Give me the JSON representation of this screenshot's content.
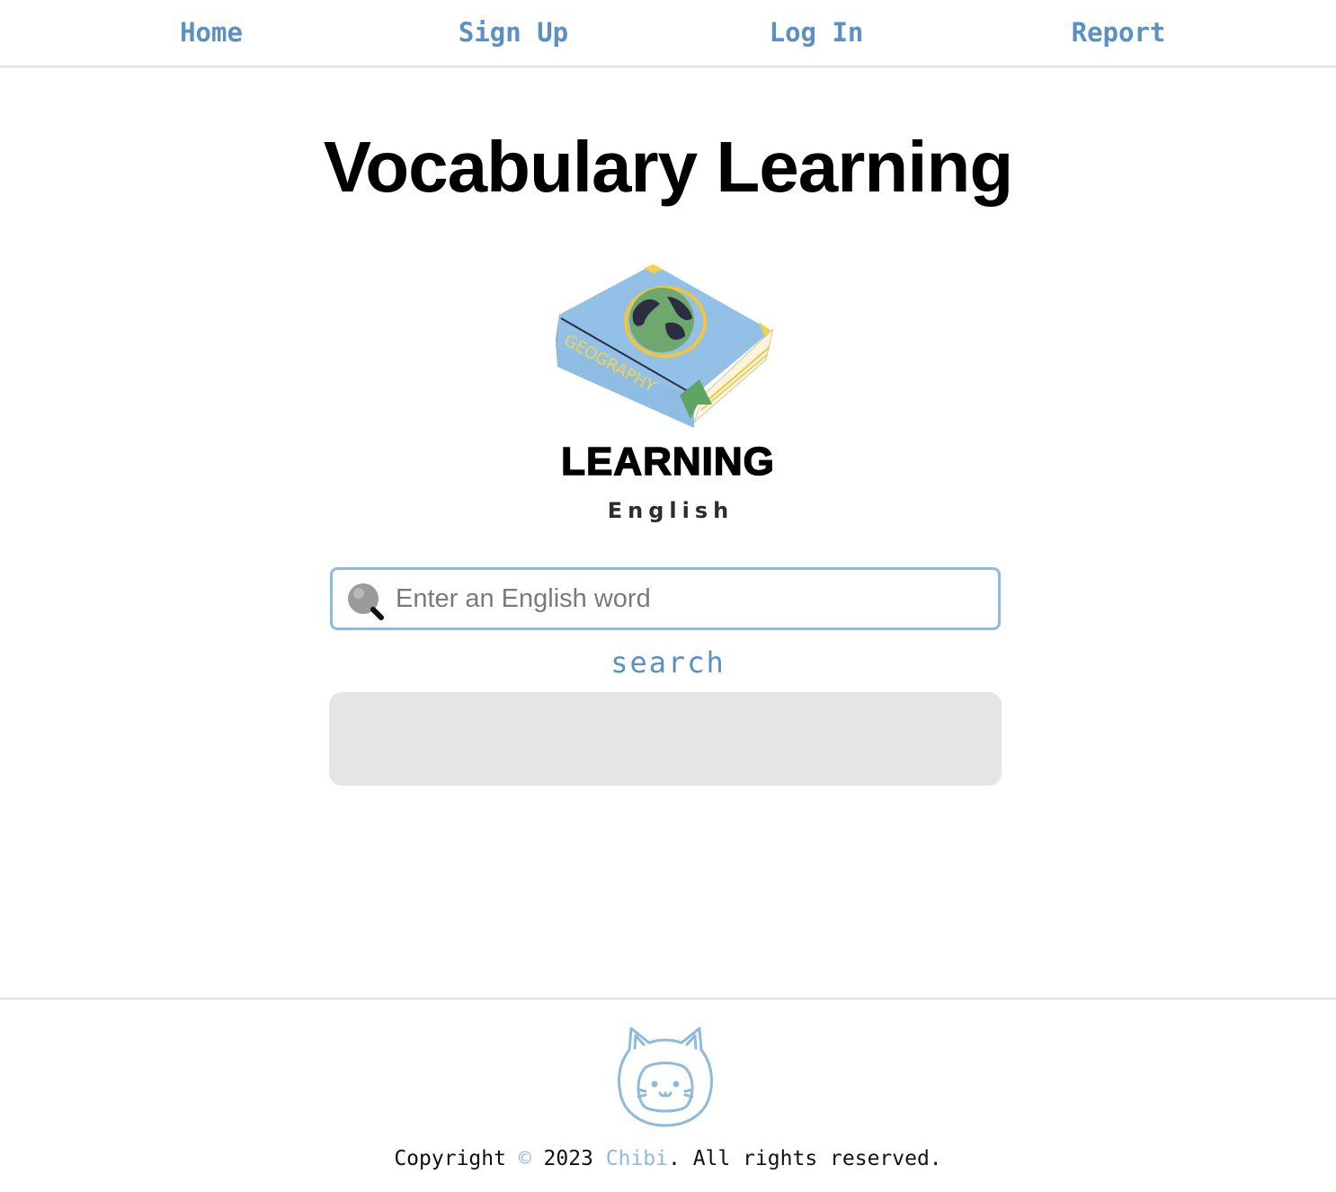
{
  "nav": {
    "items": [
      {
        "label": "Home"
      },
      {
        "label": "Sign Up"
      },
      {
        "label": "Log In"
      },
      {
        "label": "Report"
      }
    ]
  },
  "page": {
    "title": "Vocabulary Learning"
  },
  "logo": {
    "book_spine_text": "GEOGRAPHY",
    "word": "LEARNING",
    "subtitle": "English"
  },
  "search": {
    "placeholder": "Enter an English word",
    "value": "",
    "button_label": "search"
  },
  "results": {
    "text": ""
  },
  "footer": {
    "copyright_prefix": "Copyright ",
    "copyright_symbol": "©",
    "year": " 2023 ",
    "brand": "Chibi",
    "suffix": ". All rights reserved."
  },
  "colors": {
    "link": "#5b90c0",
    "accent": "#8fbadf",
    "panel": "#e5e5e5",
    "divider": "#e2e2e2"
  },
  "icons": {
    "search": "magnifier-icon",
    "mascot": "cat-mascot-icon",
    "logo": "geography-book-icon"
  }
}
